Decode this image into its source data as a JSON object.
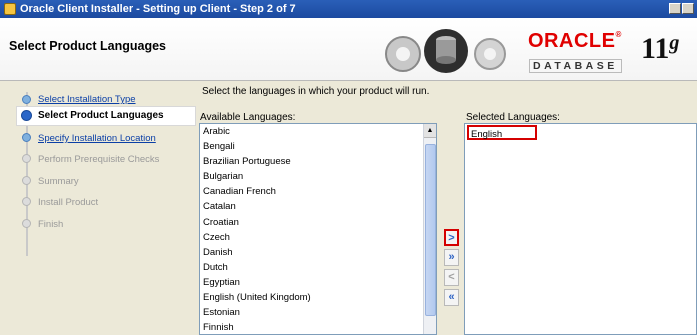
{
  "window": {
    "title": "Oracle Client Installer - Setting up Client - Step 2 of 7"
  },
  "header": {
    "step_title": "Select Product Languages",
    "brand": "ORACLE",
    "db_word": "DATABASE",
    "version": "11",
    "version_suffix": "g"
  },
  "nav": {
    "items": [
      {
        "label": "Select Installation Type",
        "state": "done"
      },
      {
        "label": "Select Product Languages",
        "state": "current"
      },
      {
        "label": "Specify Installation Location",
        "state": "done"
      },
      {
        "label": "Perform Prerequisite Checks",
        "state": "future"
      },
      {
        "label": "Summary",
        "state": "future"
      },
      {
        "label": "Install Product",
        "state": "future"
      },
      {
        "label": "Finish",
        "state": "future"
      }
    ]
  },
  "main": {
    "instruction": "Select the languages in which your product will run.",
    "available_label": "Available Languages:",
    "selected_label": "Selected Languages:",
    "available": [
      "Arabic",
      "Bengali",
      "Brazilian Portuguese",
      "Bulgarian",
      "Canadian French",
      "Catalan",
      "Croatian",
      "Czech",
      "Danish",
      "Dutch",
      "Egyptian",
      "English (United Kingdom)",
      "Estonian",
      "Finnish"
    ],
    "selected": [
      "English"
    ],
    "buttons": {
      "add": ">",
      "add_all": "»",
      "remove": "<",
      "remove_all": "«"
    }
  },
  "colors": {
    "title_bar": "#1c4aa0",
    "highlight_border": "#d40000",
    "oracle_red": "#e00000"
  }
}
